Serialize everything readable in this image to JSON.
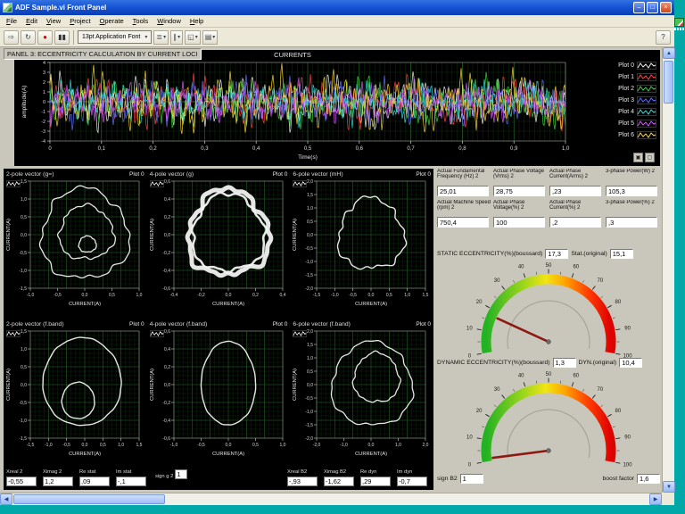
{
  "window": {
    "title": "ADF Sample.vi Front Panel"
  },
  "menu": {
    "items": [
      "File",
      "Edit",
      "View",
      "Project",
      "Operate",
      "Tools",
      "Window",
      "Help"
    ]
  },
  "toolbar": {
    "buttons": [
      {
        "name": "run-button",
        "glyph": "⇨"
      },
      {
        "name": "run-continuously-button",
        "glyph": "↻"
      },
      {
        "name": "abort-button",
        "glyph": "●",
        "style": "red"
      },
      {
        "name": "pause-button",
        "glyph": "▮▮"
      }
    ],
    "font_label": "13pt Application Font",
    "dropdowns": [
      {
        "name": "align-objects-dropdown",
        "glyph": "≣"
      },
      {
        "name": "distribute-objects-dropdown",
        "glyph": "∥"
      },
      {
        "name": "resize-objects-dropdown",
        "glyph": "◱"
      },
      {
        "name": "reorder-dropdown",
        "glyph": "▤"
      }
    ],
    "help_glyph": "?"
  },
  "panel": {
    "label": "PANEL 3: ECCENTRICITY CALCULATION BY CURRENT LOCI"
  },
  "main_chart": {
    "title": "CURRENTS",
    "ylabel": "amplitude(A)",
    "xlabel": "Time(s)",
    "y_ticks": [
      "4",
      "3",
      "2",
      "1",
      "0",
      "-1",
      "-2",
      "-3",
      "-4"
    ],
    "x_ticks": [
      "0",
      "0,1",
      "0,2",
      "0,3",
      "0,4",
      "0,5",
      "0,6",
      "0,7",
      "0,8",
      "0,9",
      "1,0"
    ],
    "legend": [
      {
        "label": "Plot 0",
        "color": "#f2f2f2"
      },
      {
        "label": "Plot 1",
        "color": "#ff4545"
      },
      {
        "label": "Plot 2",
        "color": "#3fd43f"
      },
      {
        "label": "Plot 3",
        "color": "#5f6fff"
      },
      {
        "label": "Plot 4",
        "color": "#35e0e0"
      },
      {
        "label": "Plot 5",
        "color": "#d857ff"
      },
      {
        "label": "Plot 6",
        "color": "#ffd935"
      }
    ]
  },
  "small_plots": [
    {
      "title": "2-pole vector (g=)",
      "legend": "Plot 0",
      "xlabel": "CURRENT(A)",
      "ylabel": "CURRENT(A)",
      "y_ticks": [
        "1,5",
        "1,0",
        "0,5",
        "0,0",
        "-0,5",
        "-1,0",
        "-1,5"
      ],
      "x_ticks": [
        "-1,0",
        "-0,5",
        "0,0",
        "0,5",
        "1,0"
      ],
      "rings": [
        {
          "rx": 0.8,
          "ry": 0.84,
          "cx": 0,
          "cy": 0,
          "n": 0.05,
          "w": 1.3
        },
        {
          "rx": 0.5,
          "ry": 0.5,
          "cx": 0.03,
          "cy": 0.03,
          "n": 0.05,
          "w": 1.3
        },
        {
          "rx": 0.16,
          "ry": 0.15,
          "cx": 0.05,
          "cy": -0.18,
          "n": 0.04,
          "w": 1.3
        }
      ]
    },
    {
      "title": "4-pole vector (g)",
      "legend": "Plot 0",
      "xlabel": "CURRENT(A)",
      "ylabel": "CURRENT(A)",
      "y_ticks": [
        "0,6",
        "0,4",
        "0,2",
        "0,0",
        "-0,2",
        "-0,4",
        "-0,6"
      ],
      "x_ticks": [
        "-0,4",
        "-0,2",
        "0,0",
        "0,2",
        "0,4"
      ],
      "rings": [
        {
          "rx": 0.74,
          "ry": 0.8,
          "cx": 0,
          "cy": 0.02,
          "n": 0.06,
          "w": 5
        },
        {
          "rx": 0.66,
          "ry": 0.72,
          "cx": 0,
          "cy": 0.02,
          "n": 0.05,
          "w": 2.5
        }
      ]
    },
    {
      "title": "6-pole vector (mH)",
      "legend": "Plot 0",
      "xlabel": "CURRENT(A)",
      "ylabel": "CURRENT(A)",
      "y_ticks": [
        "2,0",
        "1,5",
        "1,0",
        "0,5",
        "0,0",
        "-0,5",
        "-1,0",
        "-1,5",
        "-2,0"
      ],
      "x_ticks": [
        "-1,5",
        "-1,0",
        "-0,5",
        "0,0",
        "0,5",
        "1,0",
        "1,5"
      ],
      "rings": [
        {
          "rx": 0.6,
          "ry": 0.66,
          "cx": 0,
          "cy": 0,
          "n": 0.06,
          "w": 1.4
        }
      ]
    },
    {
      "title": "2-pole vector (f.band)",
      "legend": "Plot 0",
      "xlabel": "CURRENT(A)",
      "ylabel": "CURRENT(A)",
      "y_ticks": [
        "1,5",
        "1,0",
        "0,5",
        "0,0",
        "-0,5",
        "-1,0",
        "-1,5"
      ],
      "x_ticks": [
        "-1,5",
        "-1,0",
        "-0,5",
        "0,0",
        "0,5",
        "1,0",
        "1,5"
      ],
      "rings": [
        {
          "rx": 0.72,
          "ry": 0.82,
          "cx": -0.05,
          "cy": 0.05,
          "n": 0.01,
          "w": 1.4
        },
        {
          "rx": 0.3,
          "ry": 0.34,
          "cx": -0.12,
          "cy": -0.3,
          "n": 0.012,
          "w": 1.4
        }
      ]
    },
    {
      "title": "4-pole vector (f.band)",
      "legend": "Plot 0",
      "xlabel": "CURRENT(A)",
      "ylabel": "CURRENT(A)",
      "y_ticks": [
        "0,6",
        "0,4",
        "0,2",
        "0,0",
        "-0,2",
        "-0,4",
        "-0,6"
      ],
      "x_ticks": [
        "-1,0",
        "-0,5",
        "0,0",
        "0,5",
        "1,0"
      ],
      "rings": [
        {
          "rx": 0.5,
          "ry": 0.78,
          "cx": 0,
          "cy": 0.02,
          "n": 0.01,
          "w": 1.4
        }
      ]
    },
    {
      "title": "6-pole vector (f.band)",
      "legend": "Plot 0",
      "xlabel": "CURRENT(A)",
      "ylabel": "CURRENT(A)",
      "y_ticks": [
        "2,0",
        "1,5",
        "1,0",
        "0,5",
        "0,0",
        "-0,5",
        "-1,0",
        "-1,5",
        "-2,0"
      ],
      "x_ticks": [
        "-2,0",
        "-1,0",
        "0,0",
        "1,0",
        "2,0"
      ],
      "rings": [
        {
          "rx": 0.74,
          "ry": 0.78,
          "cx": 0.02,
          "cy": 0,
          "n": 0.035,
          "w": 1.3
        },
        {
          "rx": 0.42,
          "ry": 0.46,
          "cx": 0.1,
          "cy": 0.12,
          "n": 0.04,
          "w": 1.3
        }
      ]
    }
  ],
  "indicators": [
    {
      "label": "Actual Fundamental Frequency (Hz) 2",
      "value": "25,01"
    },
    {
      "label": "Actual Phase Voltage (Vrms) 2",
      "value": "28,75"
    },
    {
      "label": "Actual Phase Current(Arms) 2",
      "value": ",23"
    },
    {
      "label": "3-phase Power(W) 2",
      "value": "105,3"
    },
    {
      "label": "Actual Machine Speed (rpm) 2",
      "value": "750,4"
    },
    {
      "label": "Actual Phase Voltage(%) 2",
      "value": "100"
    },
    {
      "label": "Actual Phase Current(%) 2",
      "value": ",2"
    },
    {
      "label": "3-phase Power(%) 2",
      "value": ",3"
    }
  ],
  "static_ecc": {
    "label": "STATIC ECCENTRICITY(%)(boussard)",
    "value": "17,3",
    "label2": "Stat.(original)",
    "value2": "15,1"
  },
  "dynamic_ecc": {
    "label": "DYNAMIC ECCENTRICITY(%)(boussard)",
    "value": "1,3",
    "label2": "DYN.(original)",
    "value2": "10,4"
  },
  "gauges": [
    {
      "name": "static-eccentricity-gauge",
      "min": 0,
      "max": 100,
      "value": 17.3,
      "tick_labels": [
        "0",
        "10",
        "20",
        "30",
        "40",
        "50",
        "60",
        "70",
        "80",
        "90",
        "100"
      ]
    },
    {
      "name": "dynamic-eccentricity-gauge",
      "min": 0,
      "max": 100,
      "value": 1.3,
      "tick_labels": [
        "0",
        "10",
        "20",
        "30",
        "40",
        "50",
        "60",
        "70",
        "80",
        "90",
        "100"
      ]
    }
  ],
  "bottom_left": {
    "items": [
      {
        "label": "Xreal 2",
        "value": "-0,55"
      },
      {
        "label": "Ximag 2",
        "value": "1,2"
      },
      {
        "label": "Re stat",
        "value": ",09"
      },
      {
        "label": "Im stat",
        "value": "-,1"
      }
    ]
  },
  "signs": {
    "g_label": "sign g 2",
    "g_value": "1",
    "b_label": "sign B2",
    "b_value": "1"
  },
  "bottom_right": {
    "items": [
      {
        "label": "Xreal B2",
        "value": "-,93"
      },
      {
        "label": "Ximag B2",
        "value": "-1,62"
      },
      {
        "label": "Re dyn",
        "value": ",29"
      },
      {
        "label": "Im dyn",
        "value": "-0,7"
      }
    ]
  },
  "boost": {
    "label": "boost factor",
    "value": "1,6"
  }
}
